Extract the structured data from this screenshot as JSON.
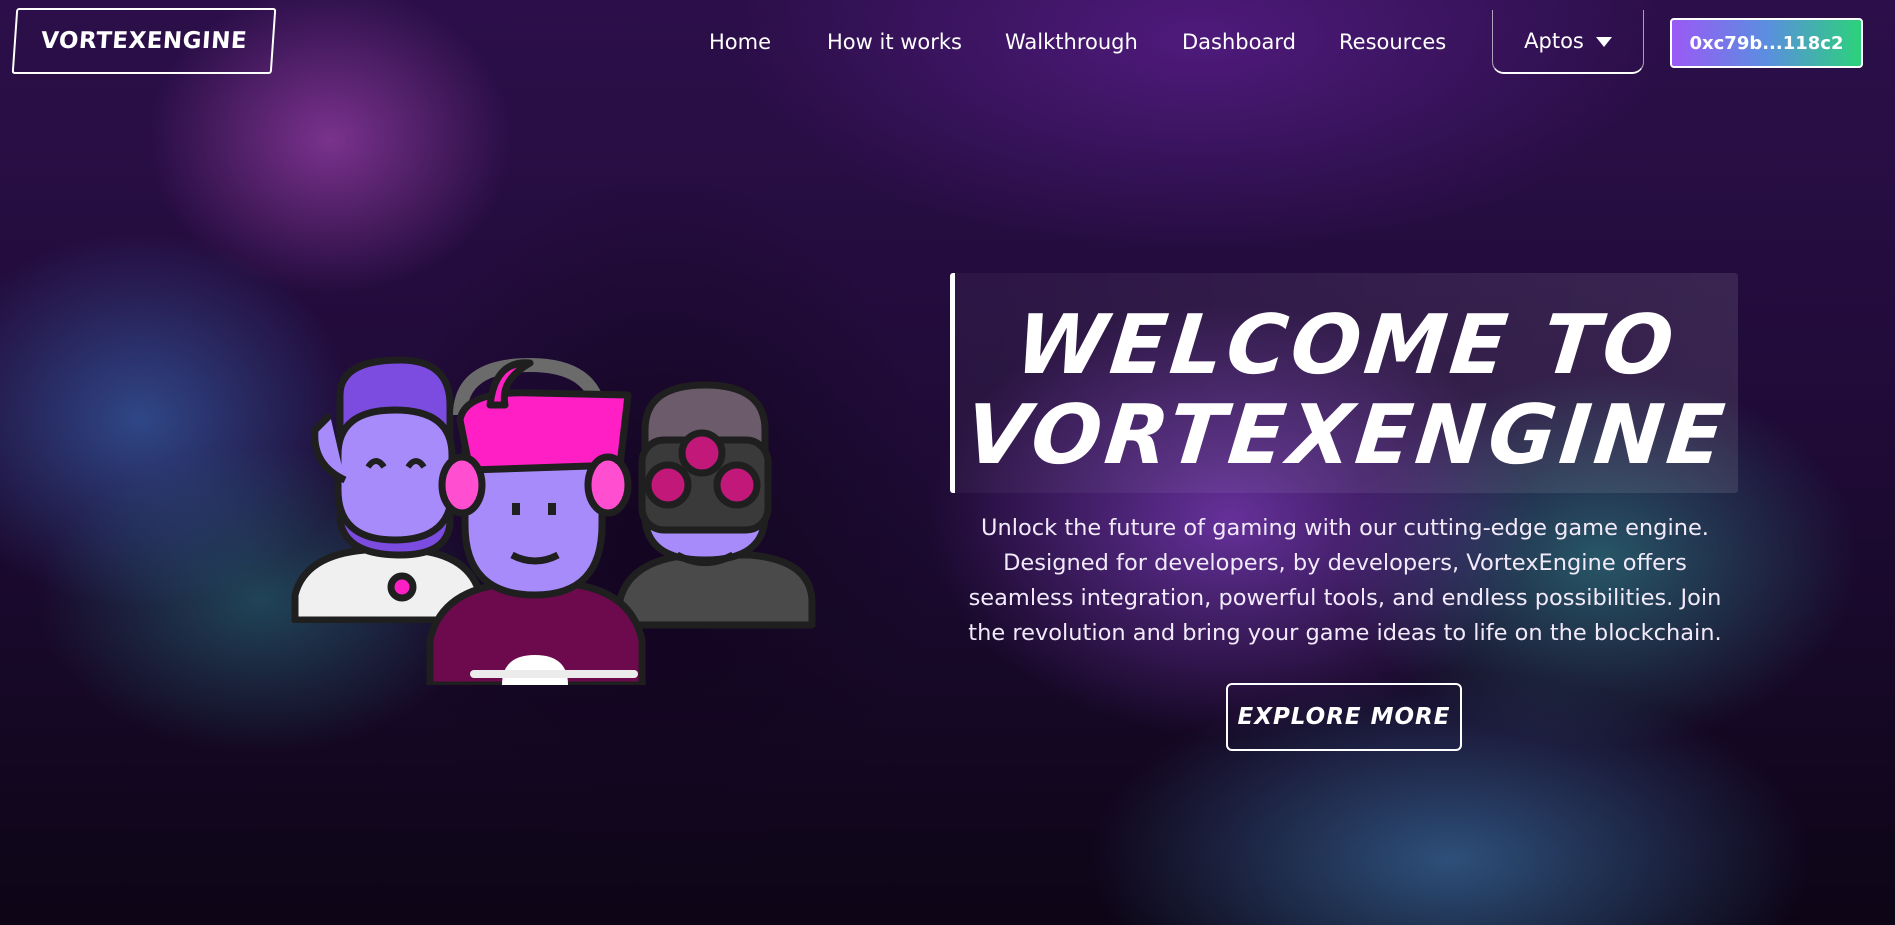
{
  "header": {
    "logo_text": "VORTEXENGINE",
    "nav": [
      "Home",
      "How it works",
      "Walkthrough",
      "Dashboard",
      "Resources"
    ],
    "network": {
      "label": "Aptos",
      "icon": "caret-down-icon"
    },
    "wallet": {
      "address": "0xc79b...118c2"
    }
  },
  "hero": {
    "title_line1": "WELCOME TO",
    "title_line2": "VORTEXENGINE",
    "description_lines": [
      "Unlock the future of gaming with our cutting-edge game engine.",
      "Designed for developers, by developers, VortexEngine offers",
      "seamless integration, powerful tools, and endless possibilities. Join",
      "the revolution and bring your game ideas to life on the blockchain."
    ],
    "cta_label": "EXPLORE MORE",
    "illustration": "gamer-avatars-illustration"
  },
  "colors": {
    "background_top": "#2c0f4a",
    "background_bottom": "#0d0516",
    "wallet_gradient_start": "#9b59f5",
    "wallet_gradient_end": "#2bd27a",
    "accent_pink": "#ff1fc4",
    "avatar_purple": "#a78bfa"
  }
}
